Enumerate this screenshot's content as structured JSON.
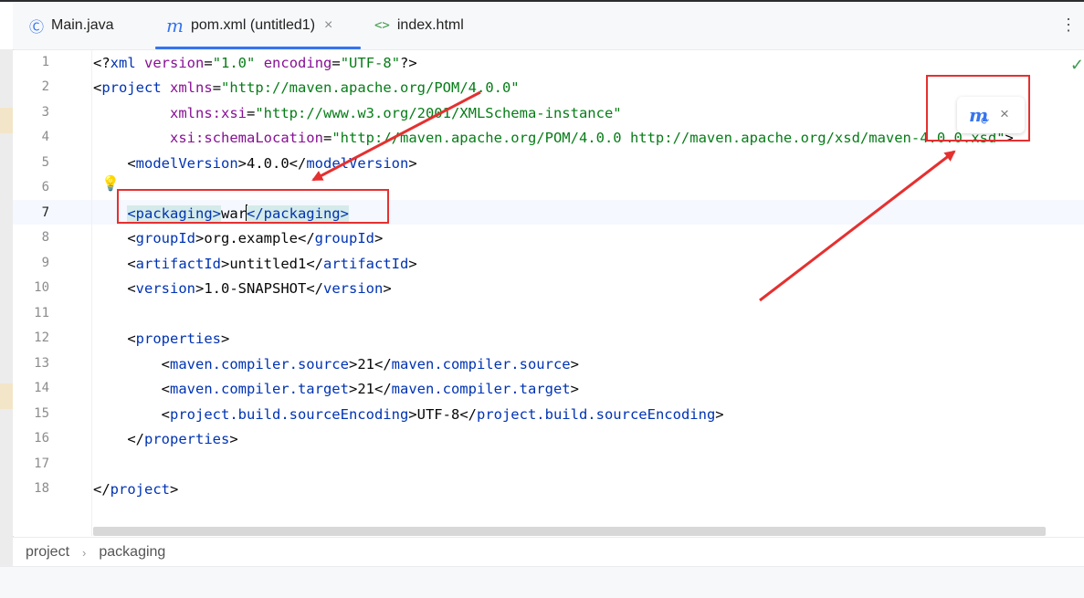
{
  "tabs": [
    {
      "icon": "Ⓒ",
      "label": "Main.java"
    },
    {
      "icon": "m",
      "label": "pom.xml (untitled1)",
      "close": "×"
    },
    {
      "icon": "<>",
      "label": "index.html"
    }
  ],
  "more_icon": "⋮",
  "line_numbers": [
    "1",
    "2",
    "3",
    "4",
    "5",
    "6",
    "7",
    "8",
    "9",
    "10",
    "11",
    "12",
    "13",
    "14",
    "15",
    "16",
    "17",
    "18"
  ],
  "code": {
    "l1": {
      "a": "<?",
      "b": "xml",
      "c": " ",
      "d": "version",
      "e": "=",
      "f": "\"1.0\"",
      "g": " ",
      "h": "encoding",
      "i": "=",
      "j": "\"UTF-8\"",
      "k": "?>"
    },
    "l2": {
      "a": "<",
      "b": "project",
      "c": " ",
      "d": "xmlns",
      "e": "=",
      "f": "\"http://maven.apache.org/POM/4.0.0\""
    },
    "l3": {
      "a": "         ",
      "b": "xmlns:xsi",
      "c": "=",
      "d": "\"http://www.w3.org/2001/XMLSchema-instance\""
    },
    "l4": {
      "a": "         ",
      "b": "xsi:schemaLocation",
      "c": "=",
      "d": "\"http://maven.apache.org/POM/4.0.0 http://maven.apache.org/xsd/maven-4.0.0.xsd\"",
      "e": ">"
    },
    "l5": {
      "pre": "    ",
      "o1": "<",
      "t1": "modelVersion",
      "c1": ">",
      "val": "4.0.0",
      "o2": "</",
      "t2": "modelVersion",
      "c2": ">"
    },
    "l7": {
      "pre": "    ",
      "open": "<packaging>",
      "val1": "war",
      "val2": "",
      "close": "</packaging>"
    },
    "l8": {
      "pre": "    ",
      "o1": "<",
      "t1": "groupId",
      "c1": ">",
      "val": "org.example",
      "o2": "</",
      "t2": "groupId",
      "c2": ">"
    },
    "l9": {
      "pre": "    ",
      "o1": "<",
      "t1": "artifactId",
      "c1": ">",
      "val": "untitled1",
      "o2": "</",
      "t2": "artifactId",
      "c2": ">"
    },
    "l10": {
      "pre": "    ",
      "o1": "<",
      "t1": "version",
      "c1": ">",
      "val": "1.0-SNAPSHOT",
      "o2": "</",
      "t2": "version",
      "c2": ">"
    },
    "l12": {
      "pre": "    ",
      "o1": "<",
      "t1": "properties",
      "c1": ">"
    },
    "l13": {
      "pre": "        ",
      "o1": "<",
      "t1": "maven.compiler.source",
      "c1": ">",
      "val": "21",
      "o2": "</",
      "t2": "maven.compiler.source",
      "c2": ">"
    },
    "l14": {
      "pre": "        ",
      "o1": "<",
      "t1": "maven.compiler.target",
      "c1": ">",
      "val": "21",
      "o2": "</",
      "t2": "maven.compiler.target",
      "c2": ">"
    },
    "l15": {
      "pre": "        ",
      "o1": "<",
      "t1": "project.build.sourceEncoding",
      "c1": ">",
      "val": "UTF-8",
      "o2": "</",
      "t2": "project.build.sourceEncoding",
      "c2": ">"
    },
    "l16": {
      "pre": "    ",
      "o1": "</",
      "t1": "properties",
      "c1": ">"
    },
    "l18": {
      "o1": "</",
      "t1": "project",
      "c1": ">"
    }
  },
  "maven_popup": {
    "icon": "m",
    "sync": "⟳",
    "close": "×"
  },
  "checkmark": "✓",
  "bulb": "💡",
  "breadcrumb": {
    "first": "project",
    "sep": "›",
    "second": "packaging"
  },
  "colors": {
    "accent": "#3574f0",
    "annotation": "#e53030",
    "tag": "#0033b3",
    "attr": "#871094",
    "string": "#067d17"
  }
}
